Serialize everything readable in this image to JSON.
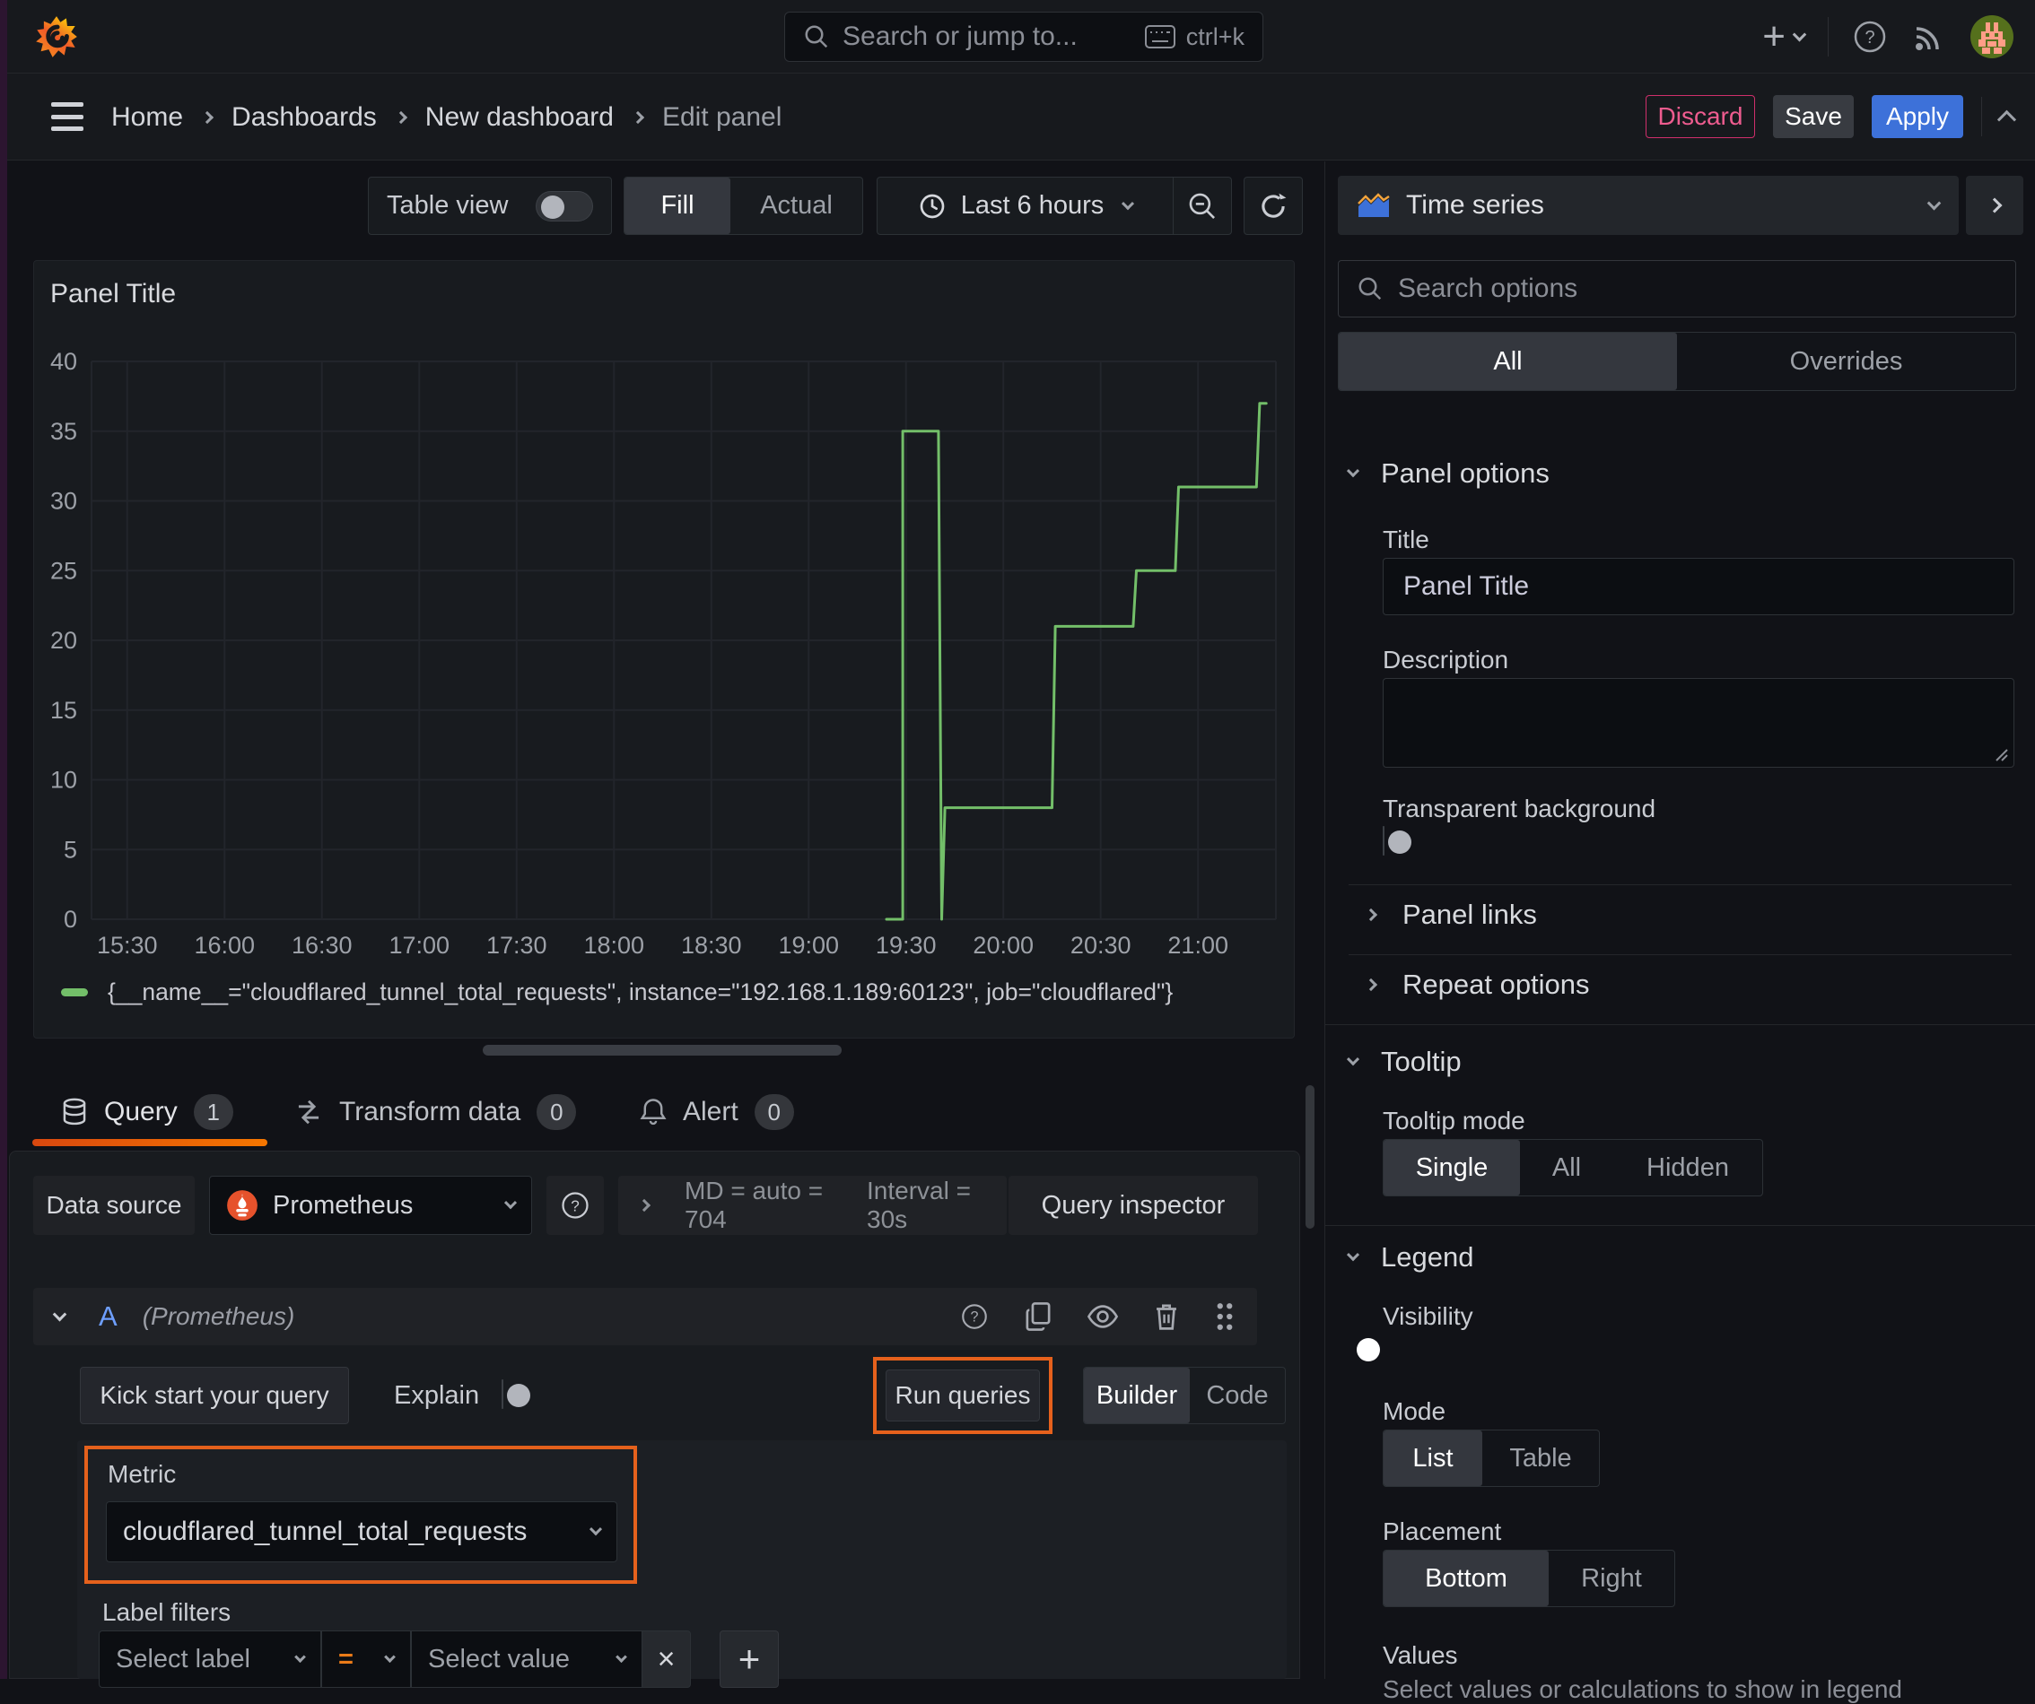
{
  "app": {
    "accent_blue": "#3d71d9",
    "accent_orange": "#eb7b18",
    "highlight_orange": "#e5611c",
    "series_green": "#73bf69",
    "destructive_pink": "#e0457c"
  },
  "topnav": {
    "search_placeholder": "Search or jump to...",
    "search_shortcut": "ctrl+k"
  },
  "breadcrumb": {
    "items": [
      "Home",
      "Dashboards",
      "New dashboard",
      "Edit panel"
    ]
  },
  "header_actions": {
    "discard": "Discard",
    "save": "Save",
    "apply": "Apply"
  },
  "panel_toolbar": {
    "table_view": "Table view",
    "fill": "Fill",
    "actual": "Actual",
    "time_range": "Last 6 hours"
  },
  "panel": {
    "title": "Panel Title"
  },
  "chart_data": {
    "type": "line",
    "title": "Panel Title",
    "x_ticks": [
      "15:30",
      "16:00",
      "16:30",
      "17:00",
      "17:30",
      "18:00",
      "18:30",
      "19:00",
      "19:30",
      "20:00",
      "20:30",
      "21:00"
    ],
    "x_domain": [
      "15:19",
      "21:24"
    ],
    "y_ticks": [
      0,
      5,
      10,
      15,
      20,
      25,
      30,
      35,
      40
    ],
    "ylim": [
      0,
      40
    ],
    "grid": true,
    "legend_position": "bottom",
    "series": [
      {
        "name": "{__name__=\"cloudflared_tunnel_total_requests\", instance=\"192.168.1.189:60123\", job=\"cloudflared\"}",
        "color": "#73bf69",
        "points": [
          [
            "19:24",
            0
          ],
          [
            "19:29",
            0
          ],
          [
            "19:29",
            35
          ],
          [
            "19:40",
            35
          ],
          [
            "19:41",
            0
          ],
          [
            "19:42",
            8
          ],
          [
            "20:15",
            8
          ],
          [
            "20:16",
            21
          ],
          [
            "20:40",
            21
          ],
          [
            "20:41",
            25
          ],
          [
            "20:53",
            25
          ],
          [
            "20:54",
            31
          ],
          [
            "21:18",
            31
          ],
          [
            "21:19",
            37
          ],
          [
            "21:21",
            37
          ]
        ]
      }
    ]
  },
  "query_tabs": [
    {
      "label": "Query",
      "count": "1"
    },
    {
      "label": "Transform data",
      "count": "0"
    },
    {
      "label": "Alert",
      "count": "0"
    }
  ],
  "datasource_row": {
    "label": "Data source",
    "name": "Prometheus",
    "stats": "MD = auto = 704",
    "interval": "Interval = 30s",
    "inspector": "Query inspector"
  },
  "query_editor": {
    "ref_id": "A",
    "datasource_hint": "(Prometheus)",
    "kick_start": "Kick start your query",
    "explain": "Explain",
    "run_queries": "Run queries",
    "builder": "Builder",
    "code": "Code",
    "metric_label": "Metric",
    "metric_value": "cloudflared_tunnel_total_requests",
    "label_filters": "Label filters",
    "select_label": "Select label",
    "operator": "=",
    "select_value": "Select value"
  },
  "viz_picker": {
    "name": "Time series"
  },
  "options_pane": {
    "search_placeholder": "Search options",
    "tabs": {
      "all": "All",
      "overrides": "Overrides"
    },
    "panel_options": {
      "title": "Panel options",
      "title_label": "Title",
      "title_value": "Panel Title",
      "description_label": "Description",
      "transparent_label": "Transparent background"
    },
    "collapsed": {
      "panel_links": "Panel links",
      "repeat_options": "Repeat options"
    },
    "tooltip": {
      "title": "Tooltip",
      "mode_label": "Tooltip mode",
      "modes": [
        "Single",
        "All",
        "Hidden"
      ],
      "selected": "Single"
    },
    "legend": {
      "title": "Legend",
      "visibility_label": "Visibility",
      "mode_label": "Mode",
      "modes": [
        "List",
        "Table"
      ],
      "selected_mode": "List",
      "placement_label": "Placement",
      "placements": [
        "Bottom",
        "Right"
      ],
      "selected_placement": "Bottom",
      "values_label": "Values",
      "values_help": "Select values or calculations to show in legend"
    }
  }
}
